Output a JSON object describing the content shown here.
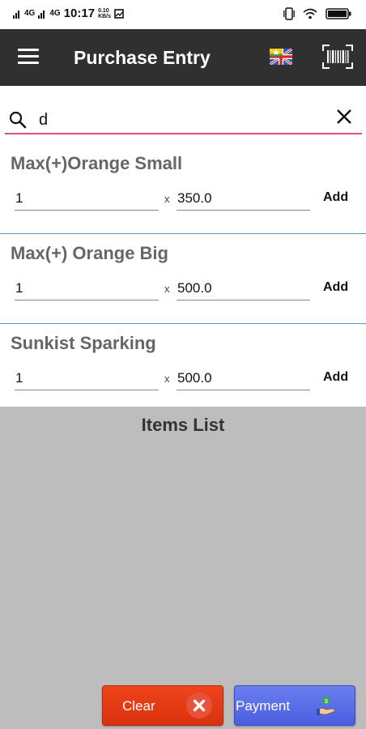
{
  "status_bar": {
    "signal_1": "4G",
    "signal_2": "4G",
    "time": "10:17",
    "net_speed_value": "0.10",
    "net_speed_unit": "KB/s"
  },
  "app_bar": {
    "title": "Purchase Entry",
    "menu_icon": "hamburger-menu-icon",
    "language_icon": "myanmar-uk-flag-icon",
    "scan_icon": "barcode-scanner-icon"
  },
  "search": {
    "value": "d",
    "placeholder": ""
  },
  "products": [
    {
      "name": "Max(+)Orange Small",
      "quantity": "1",
      "times": "x",
      "price": "350.0",
      "add_label": "Add"
    },
    {
      "name": "Max(+) Orange Big",
      "quantity": "1",
      "times": "x",
      "price": "500.0",
      "add_label": "Add"
    },
    {
      "name": "Sunkist Sparking",
      "quantity": "1",
      "times": "x",
      "price": "500.0",
      "add_label": "Add"
    }
  ],
  "items_list_heading": "Items List",
  "buttons": {
    "clear_label": "Clear",
    "payment_label": "Payment"
  },
  "colors": {
    "app_bar": "#303030",
    "search_underline": "#e0507a",
    "divider": "#4a9bb5",
    "clear_button": "#e53c16",
    "payment_button": "#5a6ee8",
    "background": "#bdbdbd"
  }
}
